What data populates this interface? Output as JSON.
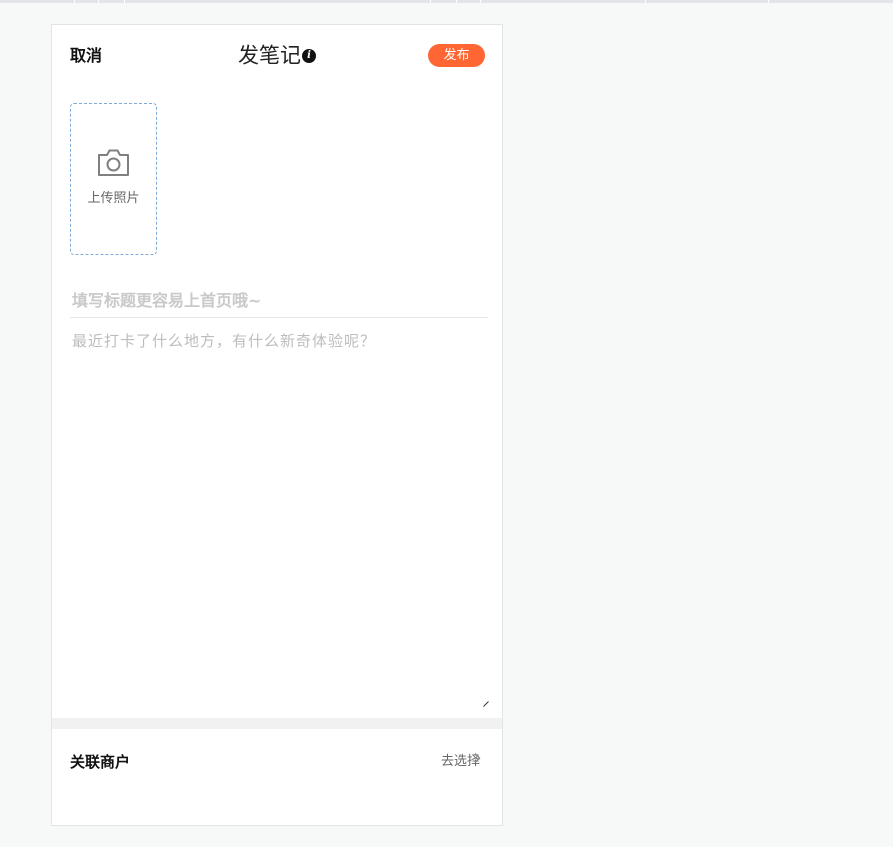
{
  "header": {
    "cancel_label": "取消",
    "title": "发笔记",
    "info_icon": "info-icon",
    "publish_label": "发布",
    "accent_color": "#ff6633"
  },
  "upload": {
    "icon": "camera-icon",
    "label": "上传照片"
  },
  "note": {
    "title_placeholder": "填写标题更容易上首页哦~",
    "body_placeholder": "最近打卡了什么地方，有什么新奇体验呢？"
  },
  "merchant": {
    "label": "关联商户",
    "select_label": "去选择",
    "chevron_icon": "chevron-right-icon"
  }
}
